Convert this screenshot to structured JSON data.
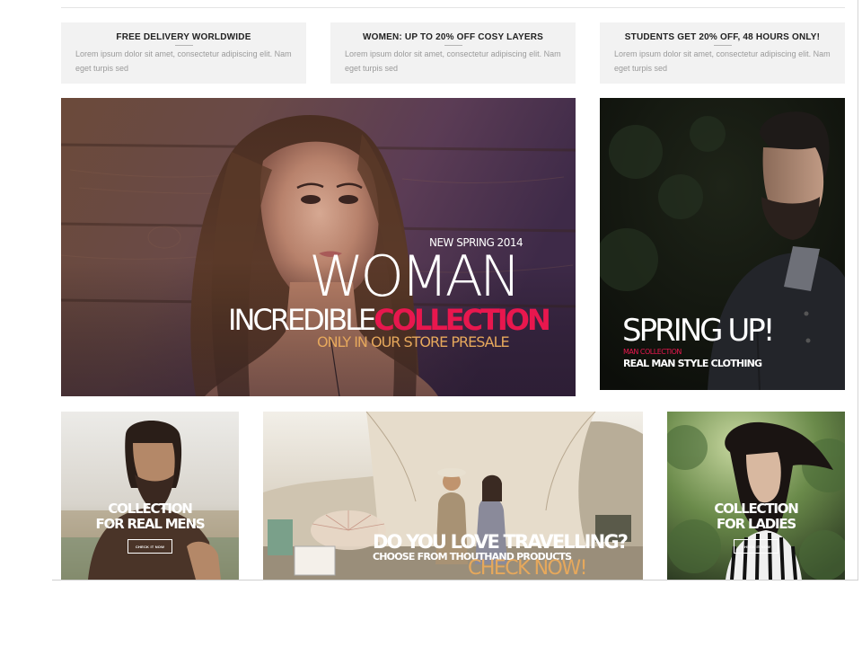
{
  "promos": [
    {
      "title": "FREE DELIVERY WORLDWIDE",
      "text": "Lorem ipsum dolor sit amet, consectetur adipiscing elit. Nam eget turpis sed"
    },
    {
      "title": "WOMEN: UP TO 20% OFF COSY LAYERS",
      "text": "Lorem ipsum dolor sit amet, consectetur adipiscing elit. Nam eget turpis sed"
    },
    {
      "title": "STUDENTS GET 20% OFF, 48 HOURS ONLY!",
      "text": "Lorem ipsum dolor sit amet, consectetur adipiscing elit. Nam eget turpis sed"
    }
  ],
  "woman_banner": {
    "kicker": "NEW SPRING 2014",
    "headline": "WOMAN",
    "line_white": "INCREDIBLE",
    "line_pink": "COLLECTION",
    "subline": "ONLY IN OUR STORE PRESALE"
  },
  "man_banner": {
    "headline": "SPRING UP!",
    "kicker": "MAN COLLECTION",
    "subline": "REAL MAN STYLE CLOTHING"
  },
  "mens_banner": {
    "line1": "COLLECTION",
    "line2": "FOR REAL MENS",
    "button": "CHECK IT NOW"
  },
  "travel_banner": {
    "headline": "DO YOU LOVE TRAVELLING?",
    "subline": "CHOOSE FROM THOUTHAND PRODUCTS",
    "cta": "CHECK NOW!"
  },
  "ladies_banner": {
    "line1": "COLLECTION",
    "line2": "FOR LADIES",
    "button": "CHECK IT NOW"
  },
  "colors": {
    "accent_pink": "#e8174e",
    "accent_gold": "#e6a85c",
    "promo_bg": "#f2f2f2"
  }
}
